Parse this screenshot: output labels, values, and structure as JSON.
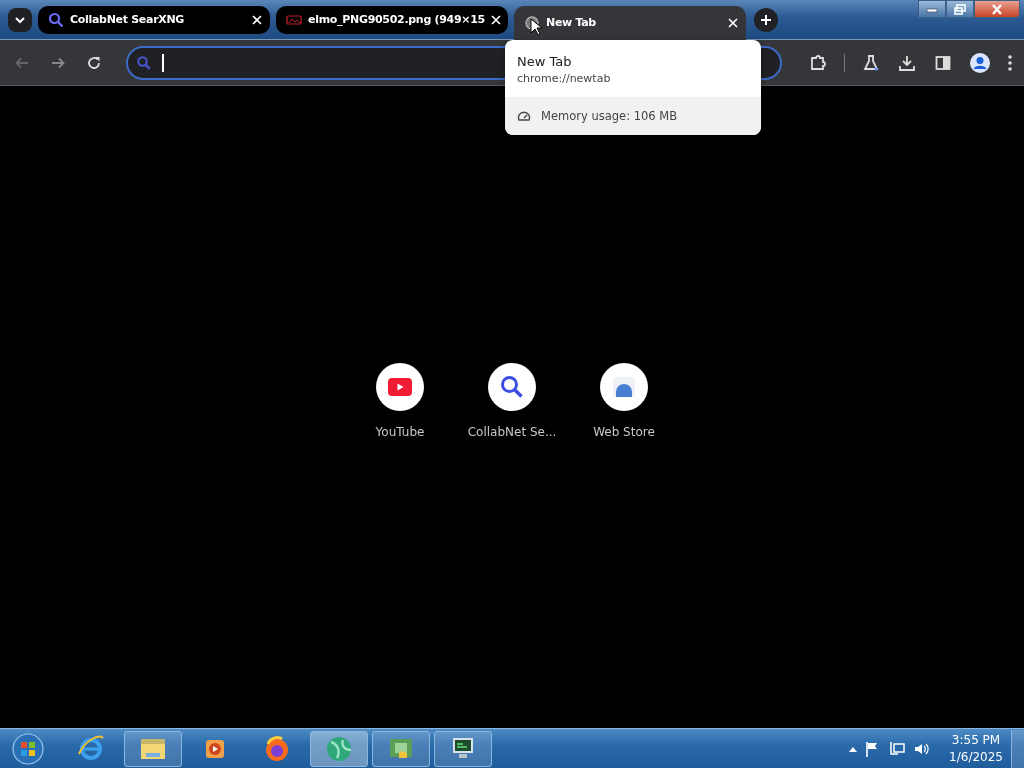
{
  "tabs": [
    {
      "title": "CollabNet SearXNG",
      "kind": "search",
      "selected": false
    },
    {
      "title": "elmo_PNG90502.png (949×15",
      "kind": "image",
      "selected": false
    },
    {
      "title": "New Tab",
      "kind": "globe",
      "selected": true
    }
  ],
  "hover_card": {
    "title": "New Tab",
    "url": "chrome://newtab",
    "memory": "Memory usage: 106 MB"
  },
  "shortcuts": [
    {
      "label": "YouTube",
      "kind": "youtube"
    },
    {
      "label": "CollabNet Se...",
      "kind": "search"
    },
    {
      "label": "Web Store",
      "kind": "store"
    }
  ],
  "taskbar": {
    "items": [
      {
        "kind": "ie",
        "running": false,
        "selected": false
      },
      {
        "kind": "folder",
        "running": true,
        "selected": false
      },
      {
        "kind": "media",
        "running": false,
        "selected": false
      },
      {
        "kind": "firefox",
        "running": false,
        "selected": false
      },
      {
        "kind": "globe",
        "running": true,
        "selected": true
      },
      {
        "kind": "network",
        "running": true,
        "selected": false
      },
      {
        "kind": "monitor",
        "running": true,
        "selected": false
      }
    ],
    "time": "3:55 PM",
    "date": "1/6/2025"
  }
}
